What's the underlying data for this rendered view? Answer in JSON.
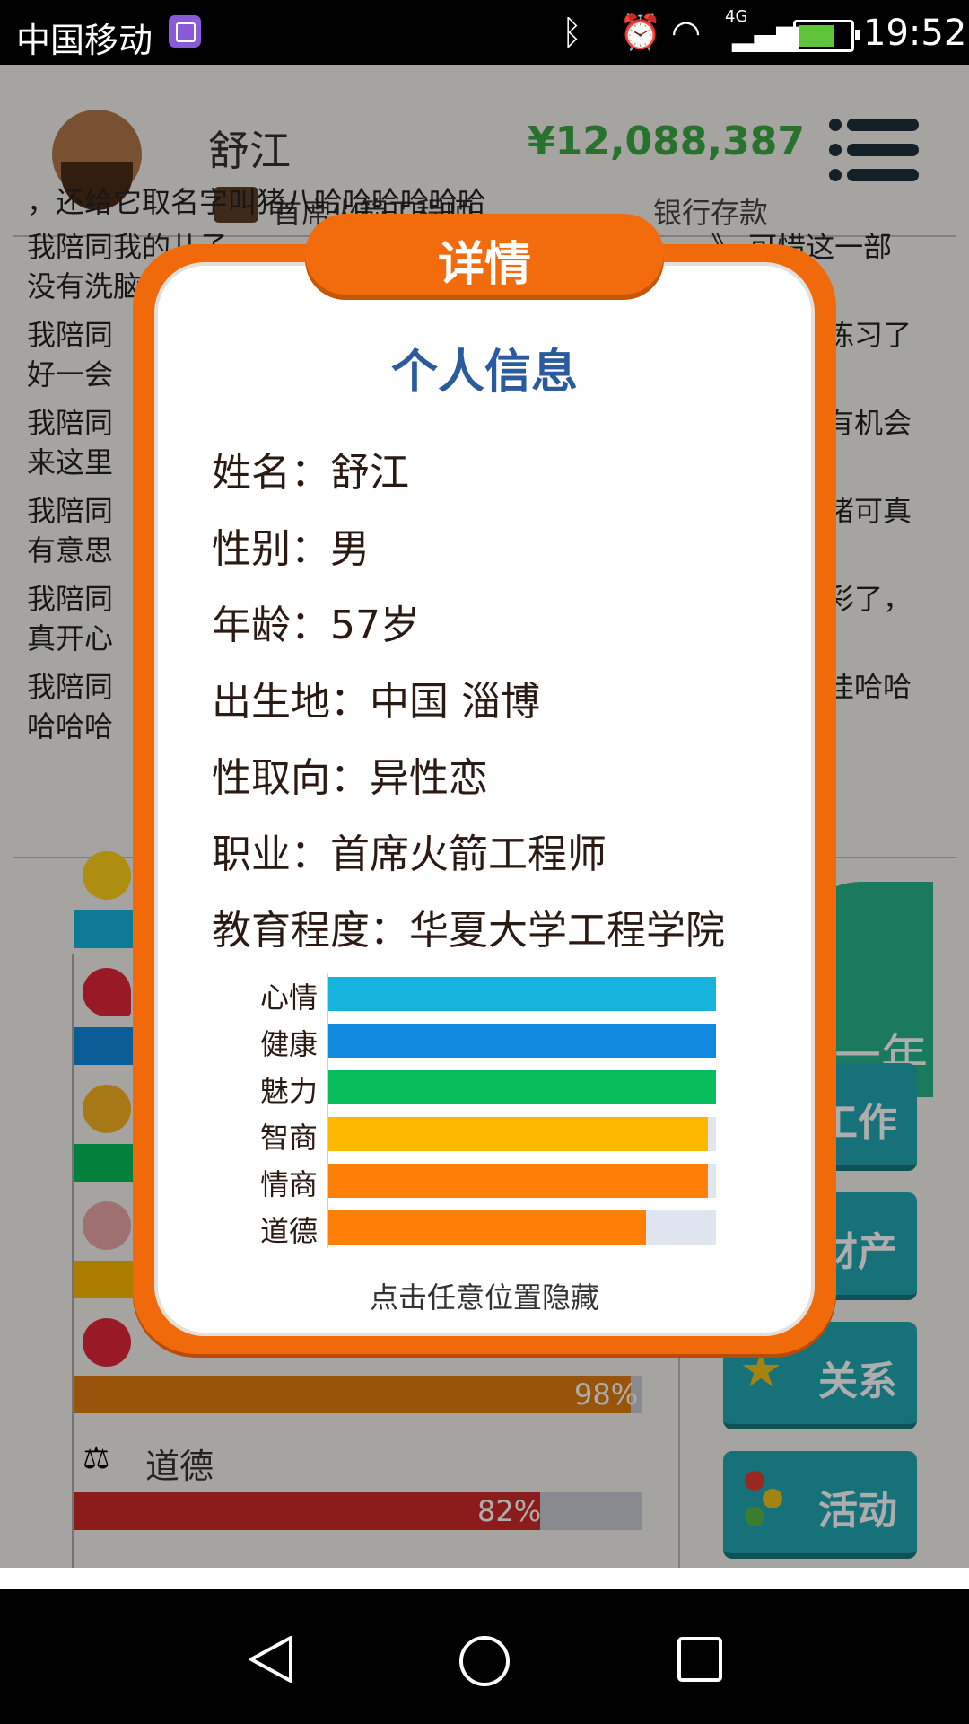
{
  "status_bar": {
    "carrier": "中国移动",
    "network": "4G",
    "time": "19:52"
  },
  "header": {
    "name": "舒江",
    "money": "¥12,088,387",
    "job": "首席火箭工程师",
    "bank_label": "银行存款"
  },
  "story": [
    "，还给它取名字叫猪八哈哈哈哈哈哈",
    "我陪同我的儿子",
    "没有洗脑",
    "我陪同",
    "好一会",
    "我陪同",
    "来这里",
    "我陪同",
    "有意思",
    "我陪同",
    "真开心",
    "我陪同",
    "哈哈哈"
  ],
  "story_right": [
    "》  可惜这一部",
    "练习了",
    "有机会",
    "猪可真",
    "彩了，",
    "哇哈哈"
  ],
  "background_stats": [
    {
      "label": "情商",
      "percent": "98%",
      "value": 98,
      "color": "#e07c10"
    },
    {
      "label": "道德",
      "percent": "82%",
      "value": 82,
      "color": "#cf2a2a"
    }
  ],
  "side_buttons": {
    "year": "一年",
    "work": "工作",
    "assets": "财产",
    "relations": "关系",
    "activities": "活动"
  },
  "dialog": {
    "title": "详情",
    "subtitle": "个人信息",
    "info": [
      "姓名：舒江",
      "性别：男",
      "年龄：57岁",
      "出生地：中国 淄博",
      "性取向：异性恋",
      "职业：首席火箭工程师",
      "教育程度：华夏大学工程学院"
    ],
    "attributes": [
      {
        "label": "心情",
        "value": 100,
        "color": "#16b4dd"
      },
      {
        "label": "健康",
        "value": 100,
        "color": "#1189e0"
      },
      {
        "label": "魅力",
        "value": 100,
        "color": "#07bd5b"
      },
      {
        "label": "智商",
        "value": 98,
        "color": "#ffb800"
      },
      {
        "label": "情商",
        "value": 98,
        "color": "#ff7f07"
      },
      {
        "label": "道德",
        "value": 82,
        "color": "#ff7f07"
      }
    ],
    "hint": "点击任意位置隐藏"
  }
}
